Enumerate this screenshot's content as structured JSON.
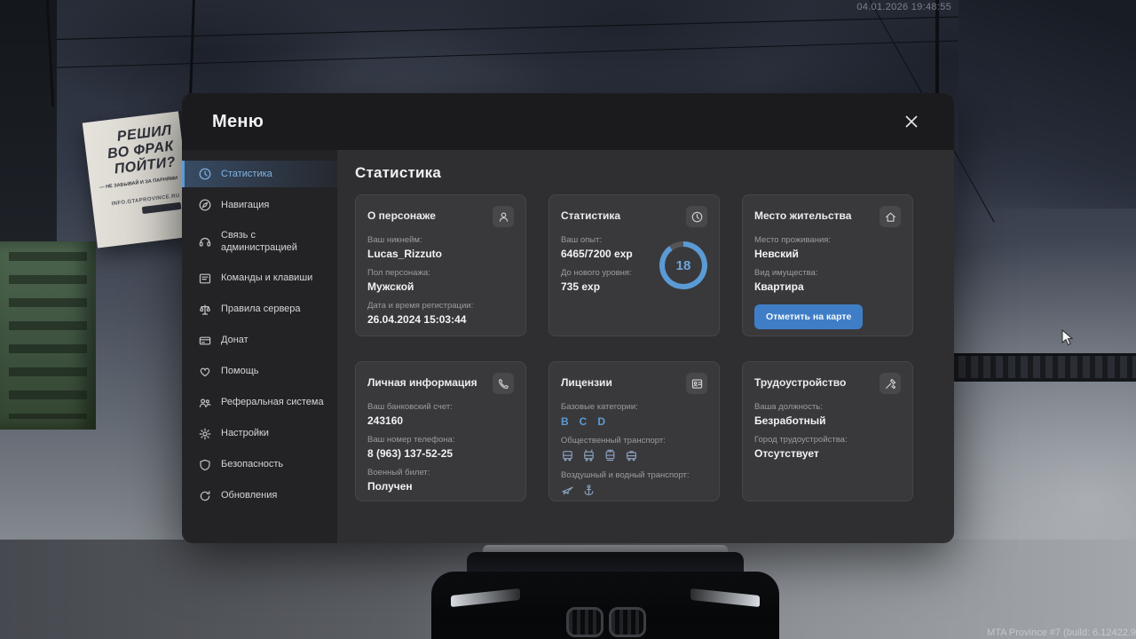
{
  "hud": {
    "datetime": "04.01.2026 19:48:55",
    "watermark": "MTA Province #7 (build: 6.12422.9",
    "billboard": {
      "line1": "РЕШИЛ",
      "line2": "ВО ФРАК",
      "line3": "ПОЙТИ?",
      "sub": "— НЕ ЗАБЫВАЙ И ЗА ПАРНЯМИ",
      "url": "INFO.GTAPROVINCE.RU"
    }
  },
  "menu": {
    "title": "Меню"
  },
  "sidebar": {
    "items": [
      {
        "label": "Статистика",
        "active": true
      },
      {
        "label": "Навигация"
      },
      {
        "label": "Связь с администрацией"
      },
      {
        "label": "Команды и клавиши"
      },
      {
        "label": "Правила сервера"
      },
      {
        "label": "Донат"
      },
      {
        "label": "Помощь"
      },
      {
        "label": "Реферальная система"
      },
      {
        "label": "Настройки"
      },
      {
        "label": "Безопасность"
      },
      {
        "label": "Обновления"
      }
    ]
  },
  "content": {
    "title": "Статистика",
    "cards": {
      "about": {
        "title": "О персонаже",
        "fields": [
          {
            "label": "Ваш никнейм:",
            "value": "Lucas_Rizzuto"
          },
          {
            "label": "Пол персонажа:",
            "value": "Мужской"
          },
          {
            "label": "Дата и время регистрации:",
            "value": "26.04.2024 15:03:44"
          }
        ]
      },
      "stats": {
        "title": "Статистика",
        "fields": [
          {
            "label": "Ваш опыт:",
            "value": "6465/7200 exp"
          },
          {
            "label": "До нового уровня:",
            "value": "735 exp"
          }
        ],
        "level": "18",
        "progress_percent": 90
      },
      "residence": {
        "title": "Место жительства",
        "fields": [
          {
            "label": "Место проживания:",
            "value": "Невский"
          },
          {
            "label": "Вид имущества:",
            "value": "Квартира"
          }
        ],
        "button": "Отметить на карте"
      },
      "personal": {
        "title": "Личная информация",
        "fields": [
          {
            "label": "Ваш банковский счет:",
            "value": "243160"
          },
          {
            "label": "Ваш номер телефона:",
            "value": "8 (963) 137-52-25"
          },
          {
            "label": "Военный билет:",
            "value": "Получен"
          }
        ]
      },
      "licenses": {
        "title": "Лицензии",
        "categories_label": "Базовые категории:",
        "categories": [
          "B",
          "C",
          "D"
        ],
        "public_transport_label": "Общественный транспорт:",
        "air_water_label": "Воздушный и водный транспорт:"
      },
      "employment": {
        "title": "Трудоустройство",
        "fields": [
          {
            "label": "Ваша должность:",
            "value": "Безработный"
          },
          {
            "label": "Город трудоустройства:",
            "value": "Отсутствует"
          }
        ]
      }
    }
  },
  "colors": {
    "accent": "#5b9bd5",
    "ring_track": "rgba(255,255,255,0.14)"
  }
}
